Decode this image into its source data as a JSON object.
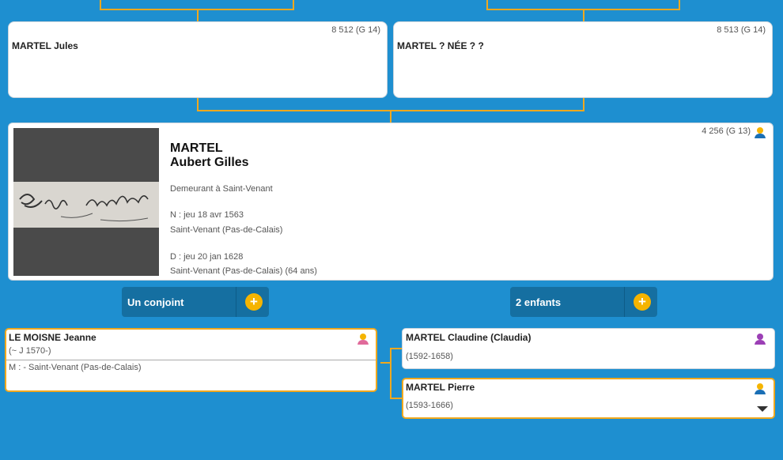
{
  "grandparents": {
    "father": {
      "name": "MARTEL Jules",
      "sosa": "8 512 (G 14)"
    },
    "mother": {
      "name": "MARTEL ? NÉE ? ?",
      "sosa": "8 513 (G 14)"
    }
  },
  "main": {
    "surname": "MARTEL",
    "given": "Aubert Gilles",
    "sosa": "4 256 (G 13)",
    "residence": "Demeurant à Saint-Venant",
    "birth_date": "N : jeu 18 avr 1563",
    "birth_place": "Saint-Venant (Pas-de-Calais)",
    "death_date": "D : jeu 20 jan 1628",
    "death_place": "Saint-Venant (Pas-de-Calais) (64 ans)",
    "signature": "Egydi martel"
  },
  "buttons": {
    "spouses": "Un conjoint",
    "children": "2 enfants",
    "plus": "+"
  },
  "spouse": {
    "name": "LE MOISNE Jeanne",
    "dates": "(~ J 1570-)",
    "marriage": "M : - Saint-Venant (Pas-de-Calais)"
  },
  "children": [
    {
      "name": "MARTEL Claudine (Claudia)",
      "dates": "(1592-1658)"
    },
    {
      "name": "MARTEL Pierre",
      "dates": "(1593-1666)"
    }
  ],
  "colors": {
    "background": "#1e8fd0",
    "connector": "#f0a81e",
    "male": "#f5b400",
    "female": "#9b3fb5",
    "button": "#156fa1"
  },
  "icons": [
    "person-male-icon",
    "person-female-icon",
    "plus-icon",
    "chevron-down-icon"
  ]
}
